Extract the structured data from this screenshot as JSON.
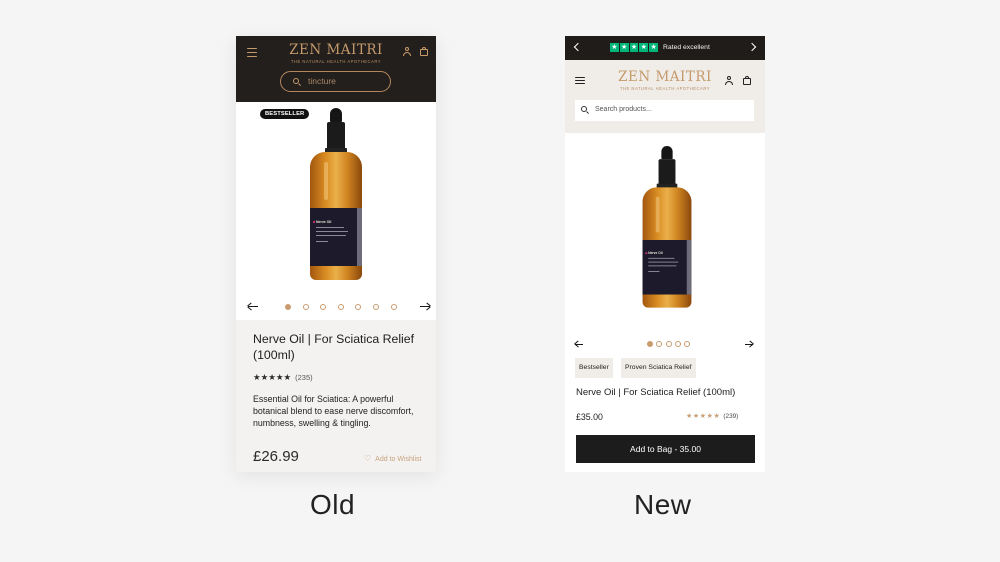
{
  "old": {
    "brand_name": "ZEN MAITRI",
    "brand_tagline": "THE NATURAL HEALTH APOTHECARY",
    "search_value": "tincture",
    "badge": "BESTSELLER",
    "bottle_label": "Nerve Oil",
    "carousel": {
      "total": 7,
      "active": 1
    },
    "product_title": "Nerve Oil | For Sciatica Relief (100ml)",
    "rating_stars": "★★★★★",
    "rating_value": 4.5,
    "review_count": "(235)",
    "description": "Essential Oil for Sciatica: A powerful botanical blend to ease nerve discomfort, numbness, swelling & tingling.",
    "price": "£26.99",
    "wishlist_label": "Add to Wishlist",
    "icons": [
      "menu-icon",
      "user-icon",
      "bag-icon",
      "search-icon",
      "arrow-left-icon",
      "arrow-right-icon",
      "heart-icon"
    ],
    "accent_color": "#c89a6b",
    "header_color": "#231f1c"
  },
  "new": {
    "top_bar": {
      "rated": "Rated excellent",
      "trustpilot_stars": "★★★★★",
      "trustpilot_color": "#00b67a"
    },
    "brand_name": "ZEN MAITRI",
    "brand_tagline": "THE NATURAL HEALTH APOTHECARY",
    "search_placeholder": "Search products...",
    "bottle_label": "Nerve Oil",
    "carousel": {
      "total": 5,
      "active": 1
    },
    "chips": [
      "Bestseller",
      "Proven Sciatica Relief"
    ],
    "product_title": "Nerve Oil | For Sciatica Relief (100ml)",
    "price": "£35.00",
    "rating_stars": "★★★★★",
    "review_count": "(239)",
    "add_to_bag": "Add to Bag - 35.00",
    "icons": [
      "chevron-left-icon",
      "chevron-right-icon",
      "menu-icon",
      "user-icon",
      "bag-icon",
      "search-icon",
      "arrow-left-icon",
      "arrow-right-icon"
    ],
    "header_bg": "#f0ece7",
    "button_color": "#1c1c1c"
  },
  "captions": {
    "old": "Old",
    "new": "New"
  }
}
